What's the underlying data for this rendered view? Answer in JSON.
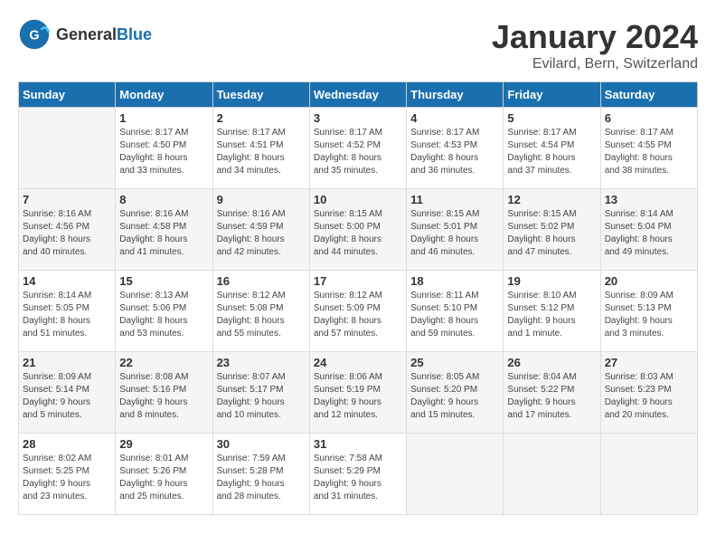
{
  "header": {
    "logo_general": "General",
    "logo_blue": "Blue",
    "month_title": "January 2024",
    "location": "Evilard, Bern, Switzerland"
  },
  "weekdays": [
    "Sunday",
    "Monday",
    "Tuesday",
    "Wednesday",
    "Thursday",
    "Friday",
    "Saturday"
  ],
  "weeks": [
    [
      {
        "day": "",
        "info": ""
      },
      {
        "day": "1",
        "info": "Sunrise: 8:17 AM\nSunset: 4:50 PM\nDaylight: 8 hours\nand 33 minutes."
      },
      {
        "day": "2",
        "info": "Sunrise: 8:17 AM\nSunset: 4:51 PM\nDaylight: 8 hours\nand 34 minutes."
      },
      {
        "day": "3",
        "info": "Sunrise: 8:17 AM\nSunset: 4:52 PM\nDaylight: 8 hours\nand 35 minutes."
      },
      {
        "day": "4",
        "info": "Sunrise: 8:17 AM\nSunset: 4:53 PM\nDaylight: 8 hours\nand 36 minutes."
      },
      {
        "day": "5",
        "info": "Sunrise: 8:17 AM\nSunset: 4:54 PM\nDaylight: 8 hours\nand 37 minutes."
      },
      {
        "day": "6",
        "info": "Sunrise: 8:17 AM\nSunset: 4:55 PM\nDaylight: 8 hours\nand 38 minutes."
      }
    ],
    [
      {
        "day": "7",
        "info": "Sunrise: 8:16 AM\nSunset: 4:56 PM\nDaylight: 8 hours\nand 40 minutes."
      },
      {
        "day": "8",
        "info": "Sunrise: 8:16 AM\nSunset: 4:58 PM\nDaylight: 8 hours\nand 41 minutes."
      },
      {
        "day": "9",
        "info": "Sunrise: 8:16 AM\nSunset: 4:59 PM\nDaylight: 8 hours\nand 42 minutes."
      },
      {
        "day": "10",
        "info": "Sunrise: 8:15 AM\nSunset: 5:00 PM\nDaylight: 8 hours\nand 44 minutes."
      },
      {
        "day": "11",
        "info": "Sunrise: 8:15 AM\nSunset: 5:01 PM\nDaylight: 8 hours\nand 46 minutes."
      },
      {
        "day": "12",
        "info": "Sunrise: 8:15 AM\nSunset: 5:02 PM\nDaylight: 8 hours\nand 47 minutes."
      },
      {
        "day": "13",
        "info": "Sunrise: 8:14 AM\nSunset: 5:04 PM\nDaylight: 8 hours\nand 49 minutes."
      }
    ],
    [
      {
        "day": "14",
        "info": "Sunrise: 8:14 AM\nSunset: 5:05 PM\nDaylight: 8 hours\nand 51 minutes."
      },
      {
        "day": "15",
        "info": "Sunrise: 8:13 AM\nSunset: 5:06 PM\nDaylight: 8 hours\nand 53 minutes."
      },
      {
        "day": "16",
        "info": "Sunrise: 8:12 AM\nSunset: 5:08 PM\nDaylight: 8 hours\nand 55 minutes."
      },
      {
        "day": "17",
        "info": "Sunrise: 8:12 AM\nSunset: 5:09 PM\nDaylight: 8 hours\nand 57 minutes."
      },
      {
        "day": "18",
        "info": "Sunrise: 8:11 AM\nSunset: 5:10 PM\nDaylight: 8 hours\nand 59 minutes."
      },
      {
        "day": "19",
        "info": "Sunrise: 8:10 AM\nSunset: 5:12 PM\nDaylight: 9 hours\nand 1 minute."
      },
      {
        "day": "20",
        "info": "Sunrise: 8:09 AM\nSunset: 5:13 PM\nDaylight: 9 hours\nand 3 minutes."
      }
    ],
    [
      {
        "day": "21",
        "info": "Sunrise: 8:09 AM\nSunset: 5:14 PM\nDaylight: 9 hours\nand 5 minutes."
      },
      {
        "day": "22",
        "info": "Sunrise: 8:08 AM\nSunset: 5:16 PM\nDaylight: 9 hours\nand 8 minutes."
      },
      {
        "day": "23",
        "info": "Sunrise: 8:07 AM\nSunset: 5:17 PM\nDaylight: 9 hours\nand 10 minutes."
      },
      {
        "day": "24",
        "info": "Sunrise: 8:06 AM\nSunset: 5:19 PM\nDaylight: 9 hours\nand 12 minutes."
      },
      {
        "day": "25",
        "info": "Sunrise: 8:05 AM\nSunset: 5:20 PM\nDaylight: 9 hours\nand 15 minutes."
      },
      {
        "day": "26",
        "info": "Sunrise: 8:04 AM\nSunset: 5:22 PM\nDaylight: 9 hours\nand 17 minutes."
      },
      {
        "day": "27",
        "info": "Sunrise: 8:03 AM\nSunset: 5:23 PM\nDaylight: 9 hours\nand 20 minutes."
      }
    ],
    [
      {
        "day": "28",
        "info": "Sunrise: 8:02 AM\nSunset: 5:25 PM\nDaylight: 9 hours\nand 23 minutes."
      },
      {
        "day": "29",
        "info": "Sunrise: 8:01 AM\nSunset: 5:26 PM\nDaylight: 9 hours\nand 25 minutes."
      },
      {
        "day": "30",
        "info": "Sunrise: 7:59 AM\nSunset: 5:28 PM\nDaylight: 9 hours\nand 28 minutes."
      },
      {
        "day": "31",
        "info": "Sunrise: 7:58 AM\nSunset: 5:29 PM\nDaylight: 9 hours\nand 31 minutes."
      },
      {
        "day": "",
        "info": ""
      },
      {
        "day": "",
        "info": ""
      },
      {
        "day": "",
        "info": ""
      }
    ]
  ]
}
